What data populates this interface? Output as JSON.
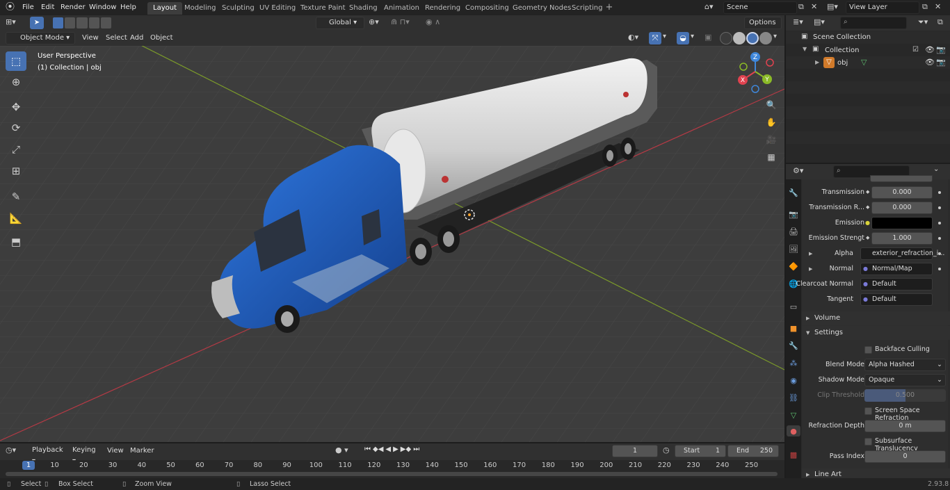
{
  "menu": [
    "File",
    "Edit",
    "Render",
    "Window",
    "Help"
  ],
  "workspaces": [
    "Layout",
    "Modeling",
    "Sculpting",
    "UV Editing",
    "Texture Paint",
    "Shading",
    "Animation",
    "Rendering",
    "Compositing",
    "Geometry Nodes",
    "Scripting"
  ],
  "scene": "Scene",
  "view_layer": "View Layer",
  "viewport_header": {
    "mode": "Object Mode",
    "menus": [
      "View",
      "Select",
      "Add",
      "Object"
    ],
    "orientation": "Global",
    "options": "Options"
  },
  "overlay": {
    "line1": "User Perspective",
    "line2": "(1) Collection | obj"
  },
  "gizmo": {
    "x": "X",
    "y": "Y",
    "z": "Z"
  },
  "outliner": {
    "scene_collection": "Scene Collection",
    "collection": "Collection",
    "object": "obj"
  },
  "props": {
    "transmission_label": "Transmission",
    "transmission_value": "0.000",
    "transmission_r_label": "Transmission R...",
    "transmission_r_value": "0.000",
    "emission_label": "Emission",
    "emission_strength_label": "Emission Strengt",
    "emission_strength_value": "1.000",
    "alpha_label": "Alpha",
    "alpha_value": "exterior_refraction_i...",
    "normal_label": "Normal",
    "normal_value": "Normal/Map",
    "clearcoat_normal_label": "Clearcoat Normal",
    "clearcoat_normal_value": "Default",
    "tangent_label": "Tangent",
    "tangent_value": "Default",
    "volume_header": "Volume",
    "settings_header": "Settings",
    "backface_culling": "Backface Culling",
    "blend_mode_label": "Blend Mode",
    "blend_mode_value": "Alpha Hashed",
    "shadow_mode_label": "Shadow Mode",
    "shadow_mode_value": "Opaque",
    "clip_threshold_label": "Clip Threshold",
    "clip_threshold_value": "0.500",
    "screen_space_refraction": "Screen Space Refraction",
    "refraction_depth_label": "Refraction Depth",
    "refraction_depth_value": "0 m",
    "subsurface_translucency": "Subsurface Translucency",
    "pass_index_label": "Pass Index",
    "pass_index_value": "0",
    "line_art_header": "Line Art"
  },
  "timeline": {
    "menus": [
      "Playback",
      "Keying",
      "View",
      "Marker"
    ],
    "current_frame": "1",
    "start_label": "Start",
    "start_value": "1",
    "end_label": "End",
    "end_value": "250",
    "ticks": [
      "1",
      "10",
      "20",
      "30",
      "40",
      "50",
      "60",
      "70",
      "80",
      "90",
      "100",
      "110",
      "120",
      "130",
      "140",
      "150",
      "160",
      "170",
      "180",
      "190",
      "200",
      "210",
      "220",
      "230",
      "240",
      "250"
    ]
  },
  "status": {
    "select": "Select",
    "box_select": "Box Select",
    "zoom_view": "Zoom View",
    "lasso_select": "Lasso Select",
    "version": "2.93.8"
  },
  "colors": {
    "accent": "#4772b3",
    "x_axis": "#e0424f",
    "y_axis": "#8bba27",
    "z_axis": "#3f87da",
    "truck_blue": "#1f5fc4"
  }
}
